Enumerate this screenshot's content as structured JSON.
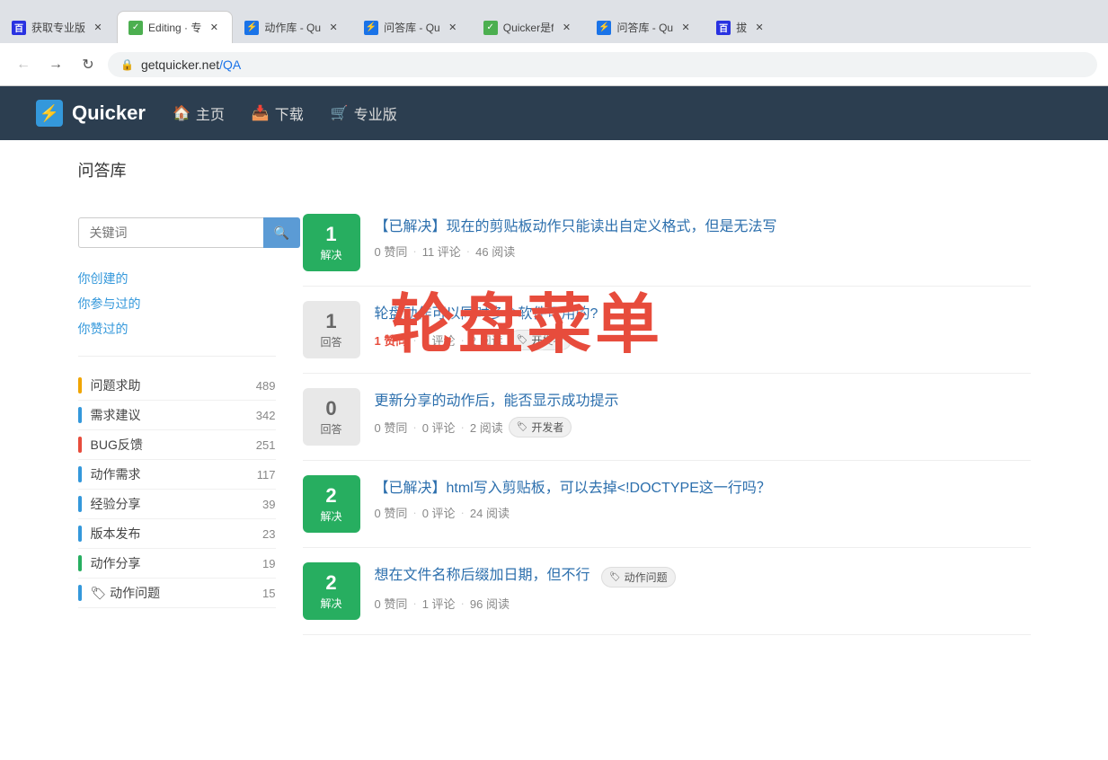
{
  "browser": {
    "tabs": [
      {
        "id": "tab1",
        "label": "获取专业版",
        "icon_type": "baidu",
        "icon_text": "百",
        "active": false
      },
      {
        "id": "tab2",
        "label": "Editing · 专",
        "icon_type": "green",
        "icon_text": "✓",
        "active": true
      },
      {
        "id": "tab3",
        "label": "动作库 - Qu",
        "icon_type": "quicker",
        "icon_text": "⚡",
        "active": false
      },
      {
        "id": "tab4",
        "label": "问答库 - Qu",
        "icon_type": "quicker",
        "icon_text": "⚡",
        "active": false
      },
      {
        "id": "tab5",
        "label": "Quicker是f",
        "icon_type": "green",
        "icon_text": "✓",
        "active": false
      },
      {
        "id": "tab6",
        "label": "问答库 - Qu",
        "icon_type": "quicker",
        "icon_text": "⚡",
        "active": false
      },
      {
        "id": "tab7",
        "label": "拔",
        "icon_type": "baidu",
        "icon_text": "百",
        "active": false
      }
    ],
    "url_domain": "getquicker.net",
    "url_path": "/QA"
  },
  "nav": {
    "logo_text": "Quicker",
    "logo_icon": "⚡",
    "links": [
      {
        "id": "home",
        "icon": "🏠",
        "label": "主页"
      },
      {
        "id": "download",
        "icon": "📥",
        "label": "下载"
      },
      {
        "id": "pro",
        "icon": "🛒",
        "label": "专业版"
      }
    ]
  },
  "page": {
    "breadcrumb": "问答库",
    "search_placeholder": "关键词",
    "sidebar_links": [
      {
        "id": "created",
        "label": "你创建的"
      },
      {
        "id": "participated",
        "label": "你参与过的"
      },
      {
        "id": "liked",
        "label": "你赞过的"
      }
    ],
    "categories": [
      {
        "id": "help",
        "label": "问题求助",
        "count": "489",
        "color": "#f0a500"
      },
      {
        "id": "feature",
        "label": "需求建议",
        "count": "342",
        "color": "#3498db"
      },
      {
        "id": "bug",
        "label": "BUG反馈",
        "count": "251",
        "color": "#e74c3c"
      },
      {
        "id": "action",
        "label": "动作需求",
        "count": "117",
        "color": "#3498db"
      },
      {
        "id": "exp",
        "label": "经验分享",
        "count": "39",
        "color": "#3498db"
      },
      {
        "id": "release",
        "label": "版本发布",
        "count": "23",
        "color": "#3498db"
      },
      {
        "id": "share",
        "label": "动作分享",
        "count": "19",
        "color": "#27ae60"
      },
      {
        "id": "action_q",
        "label": "动作问题",
        "count": "15",
        "color": "#3498db"
      }
    ],
    "questions": [
      {
        "id": "q1",
        "solved": true,
        "answer_count": "1",
        "answer_label": "解决",
        "title": "【已解决】现在的剪贴板动作只能读出自定义格式，但是无法写",
        "likes": "0 赞同",
        "comments": "11 评论",
        "reads": "46 阅读",
        "tags": []
      },
      {
        "id": "q2",
        "solved": false,
        "answer_count": "1",
        "answer_label": "回答",
        "title": "轮盘动作可以同时多个软件可用的?",
        "likes": "1 赞同",
        "comments": "0 评论",
        "reads": "2 阅读",
        "tags": [
          "开发者"
        ],
        "likes_highlight": true
      },
      {
        "id": "q3",
        "solved": false,
        "answer_count": "0",
        "answer_label": "回答",
        "title": "更新分享的动作后，能否显示成功提示",
        "likes": "0 赞同",
        "comments": "0 评论",
        "reads": "2 阅读",
        "tags": [
          "开发者"
        ]
      },
      {
        "id": "q4",
        "solved": true,
        "answer_count": "2",
        "answer_label": "解决",
        "title": "【已解决】html写入剪贴板，可以去掉<!DOCTYPE这一行吗？",
        "likes": "0 赞同",
        "comments": "0 评论",
        "reads": "24 阅读",
        "tags": []
      },
      {
        "id": "q5",
        "solved": true,
        "answer_count": "2",
        "answer_label": "解决",
        "title": "想在文件名称后缀加日期，但不行",
        "likes": "0 赞同",
        "comments": "1 评论",
        "reads": "96 阅读",
        "tags": [
          "动作问题"
        ]
      }
    ],
    "overlay_text": "轮盘菜单"
  }
}
